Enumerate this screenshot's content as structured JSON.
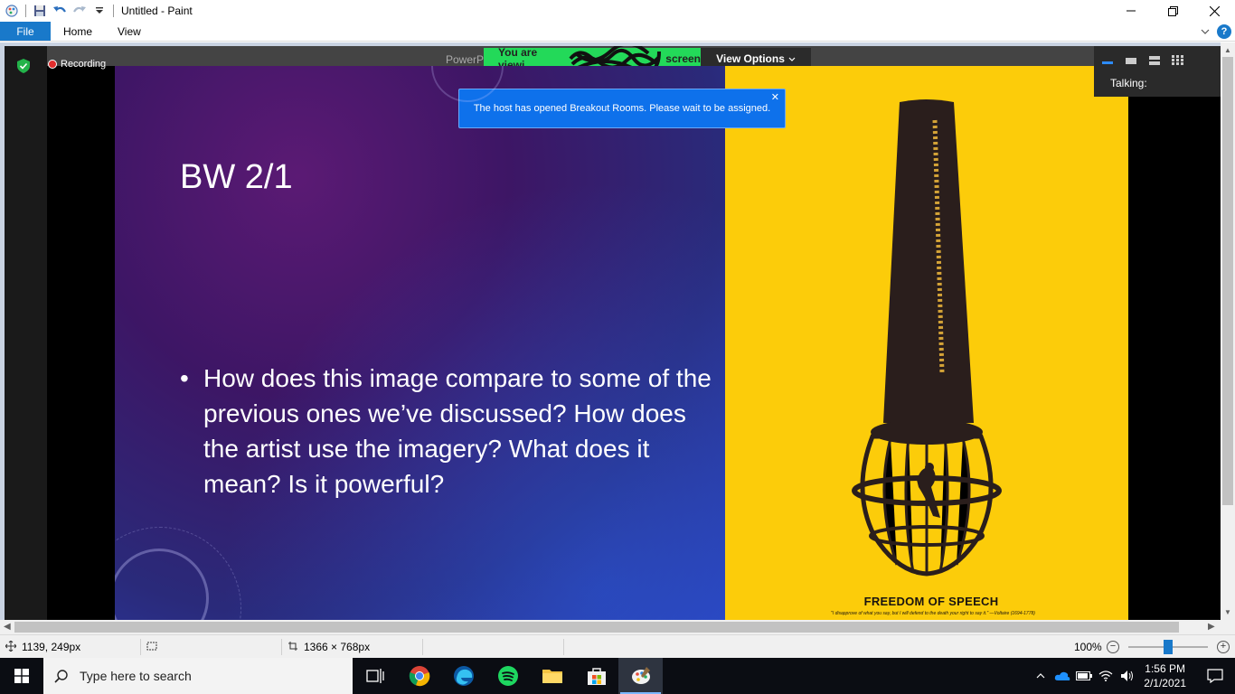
{
  "window": {
    "title": "Untitled - Paint"
  },
  "ribbon": {
    "tabs": [
      "File",
      "Home",
      "View"
    ]
  },
  "zoom_meeting": {
    "recording_label": "Recording",
    "app_label": "PowerPo",
    "viewing_text": "You are viewi",
    "viewing_text_end": "screen",
    "view_options": "View Options",
    "notification": "The host has opened Breakout Rooms. Please wait to be assigned.",
    "talking_label": "Talking:"
  },
  "slide": {
    "title": "BW 2/1",
    "bullet": "How does this image compare to some of the previous ones we’ve discussed? How does the artist use the imagery? What does it mean? Is it powerful?",
    "poster_caption": "FREEDOM OF SPEECH",
    "poster_quote": "\"I disapprove of what you say, but I will defend to the death your right to say it.\" —Voltaire (1694-1778)"
  },
  "statusbar": {
    "cursor_position": "1139, 249px",
    "image_size": "1366 × 768px",
    "zoom": "100%"
  },
  "taskbar": {
    "search_placeholder": "Type here to search",
    "time": "1:56 PM",
    "date": "2/1/2021"
  },
  "colors": {
    "paint_accent": "#1979ca",
    "zoom_green": "#23d959",
    "zoom_blue": "#0e71eb",
    "poster_yellow": "#fccc0a"
  }
}
